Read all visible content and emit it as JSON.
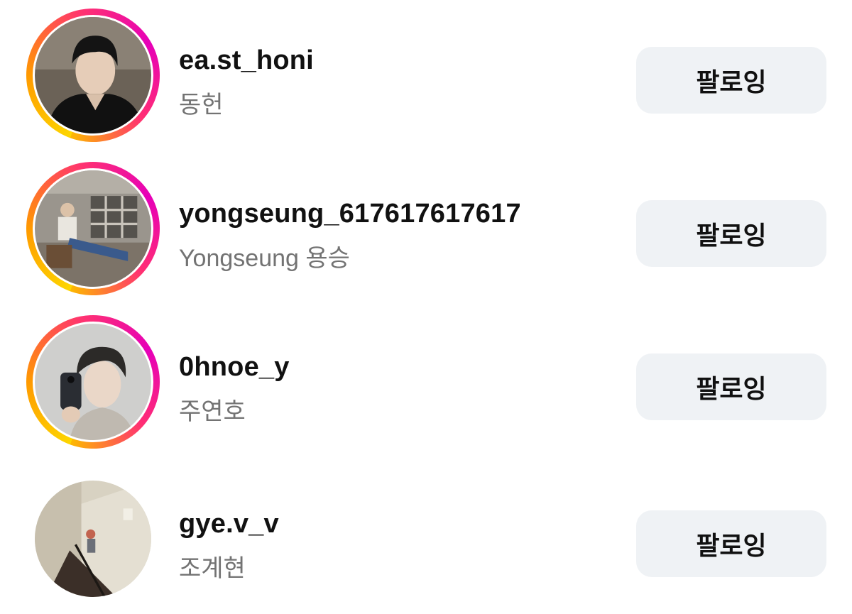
{
  "following_list": [
    {
      "username": "ea.st_honi",
      "full_name": "동헌",
      "has_story": true,
      "avatar_icon": "profile-photo",
      "button_label": "팔로잉"
    },
    {
      "username": "yongseung_617617617617",
      "full_name": "Yongseung 용승",
      "has_story": true,
      "avatar_icon": "profile-photo",
      "button_label": "팔로잉"
    },
    {
      "username": "0hnoe_y",
      "full_name": "주연호",
      "has_story": true,
      "avatar_icon": "profile-photo",
      "button_label": "팔로잉"
    },
    {
      "username": "gye.v_v",
      "full_name": "조계현",
      "has_story": false,
      "avatar_icon": "profile-photo",
      "button_label": "팔로잉"
    }
  ],
  "colors": {
    "story_ring_start": "#fdd600",
    "story_ring_end": "#e600b8",
    "button_bg": "#eff2f5",
    "username_text": "#111111",
    "fullname_text": "#737373"
  }
}
